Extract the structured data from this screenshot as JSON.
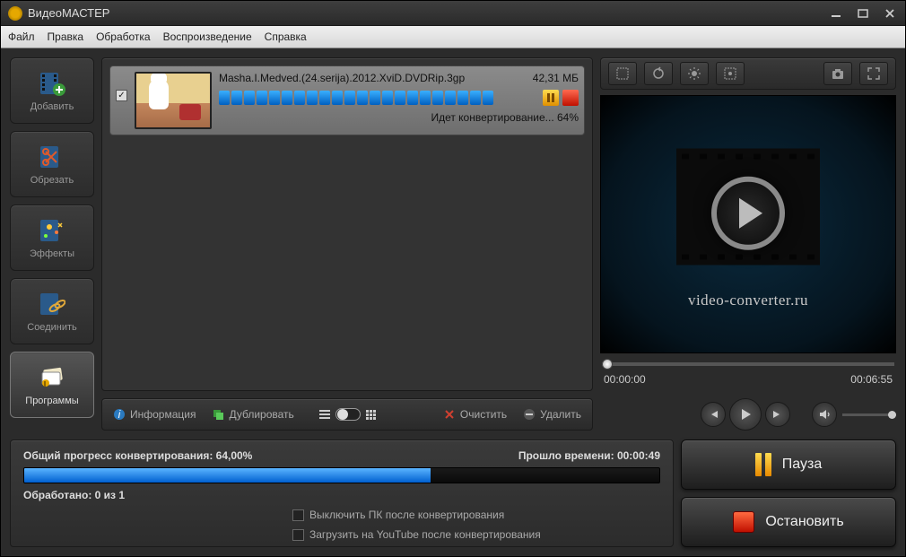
{
  "app": {
    "title": "ВидеоМАСТЕР"
  },
  "menu": {
    "file": "Файл",
    "edit": "Правка",
    "process": "Обработка",
    "playback": "Воспроизведение",
    "help": "Справка"
  },
  "tools": {
    "add": "Добавить",
    "cut": "Обрезать",
    "effects": "Эффекты",
    "join": "Соединить",
    "programs": "Программы"
  },
  "file": {
    "name": "Masha.I.Medved.(24.serija).2012.XviD.DVDRip.3gp",
    "size": "42,31 МБ",
    "status": "Идет конвертирование... 64%"
  },
  "listbar": {
    "info": "Информация",
    "duplicate": "Дублировать",
    "clear": "Очистить",
    "delete": "Удалить"
  },
  "preview": {
    "brand": "video-converter.ru",
    "time_current": "00:00:00",
    "time_total": "00:06:55"
  },
  "progress": {
    "overall_label": "Общий прогресс конвертирования: 64,00%",
    "elapsed": "Прошло времени: 00:00:49",
    "processed": "Обработано: 0 из 1",
    "shutdown": "Выключить ПК после конвертирования",
    "youtube": "Загрузить на YouTube после конвертирования"
  },
  "actions": {
    "pause": "Пауза",
    "stop": "Остановить"
  }
}
